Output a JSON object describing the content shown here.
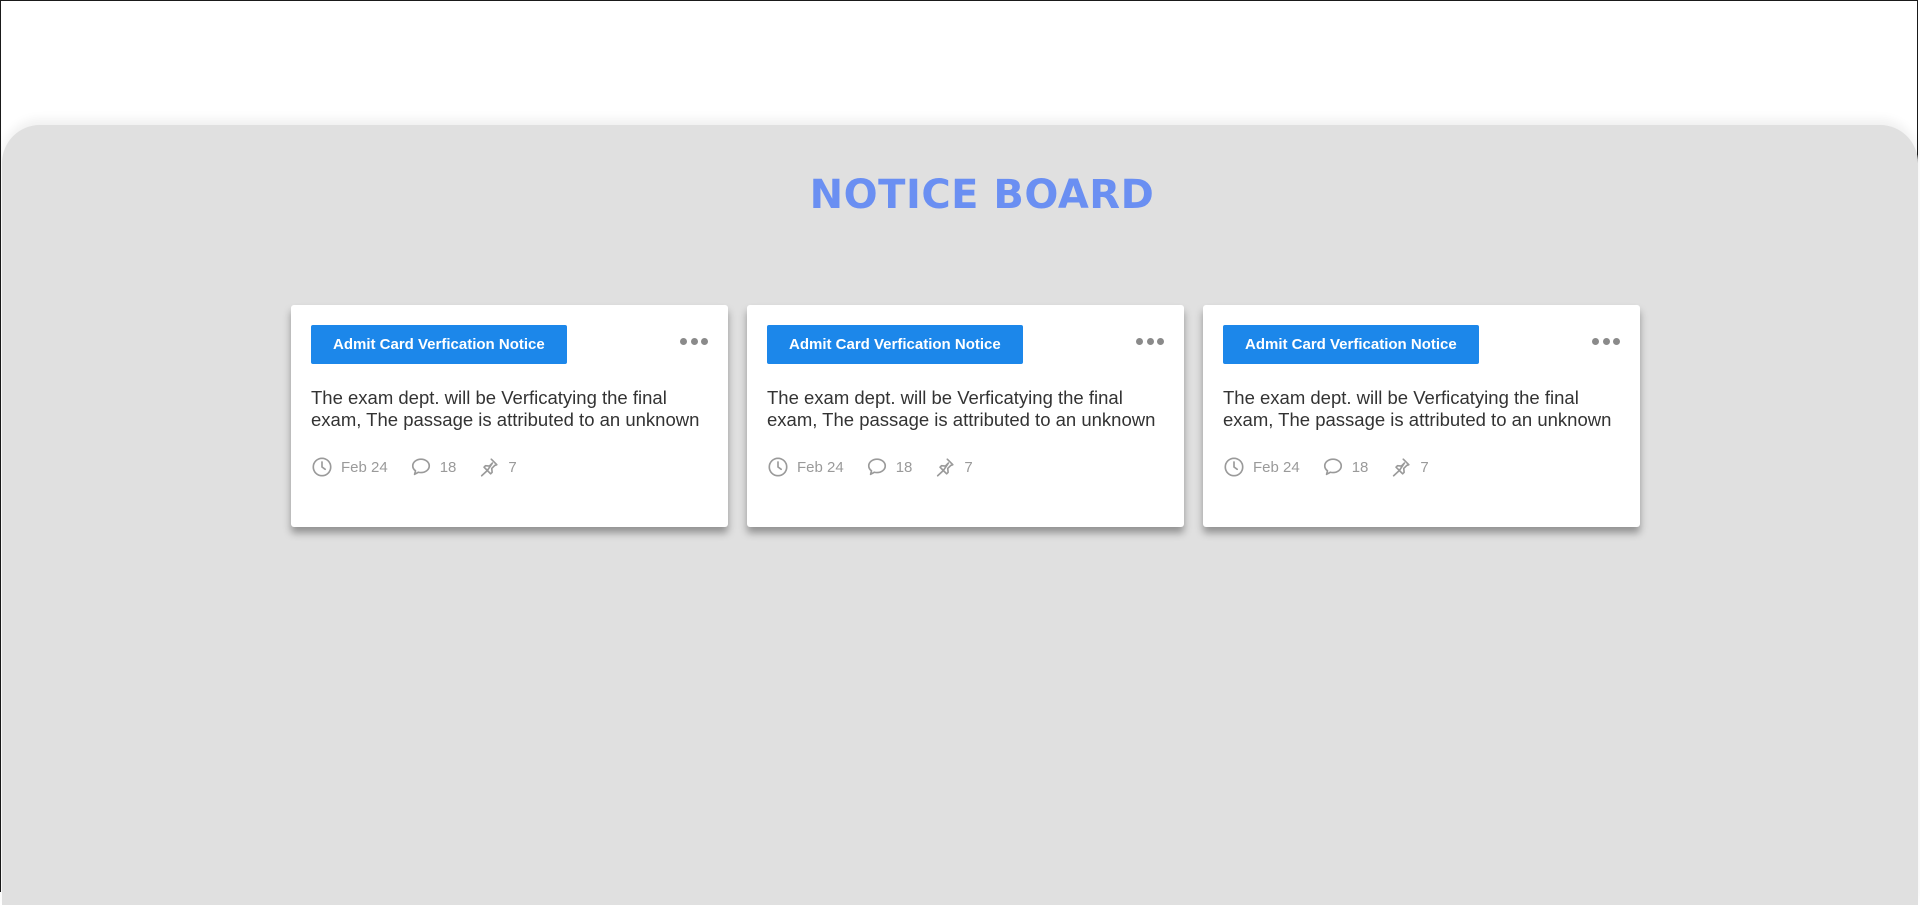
{
  "board": {
    "title": "NOTICE BOARD"
  },
  "colors": {
    "title": "#6a8ff2",
    "tag_bg": "#1c87ea",
    "board_bg": "#e0e0e0"
  },
  "cards": [
    {
      "tag": "Admit Card Verfication Notice",
      "text": "The exam dept. will be Verficatying the final\nexam, The passage is attributed to an unknown",
      "date": "Feb 24",
      "comments": "18",
      "pins": "7"
    },
    {
      "tag": "Admit Card Verfication Notice",
      "text": "The exam dept. will be Verficatying the final\nexam, The passage is attributed to an unknown",
      "date": "Feb 24",
      "comments": "18",
      "pins": "7"
    },
    {
      "tag": "Admit Card Verfication Notice",
      "text": "The exam dept. will be Verficatying the final\nexam, The passage is attributed to an unknown",
      "date": "Feb 24",
      "comments": "18",
      "pins": "7"
    }
  ],
  "icons": {
    "menu": "more-horizontal-icon",
    "date": "clock-icon",
    "comments": "comment-icon",
    "pins": "pin-icon"
  }
}
